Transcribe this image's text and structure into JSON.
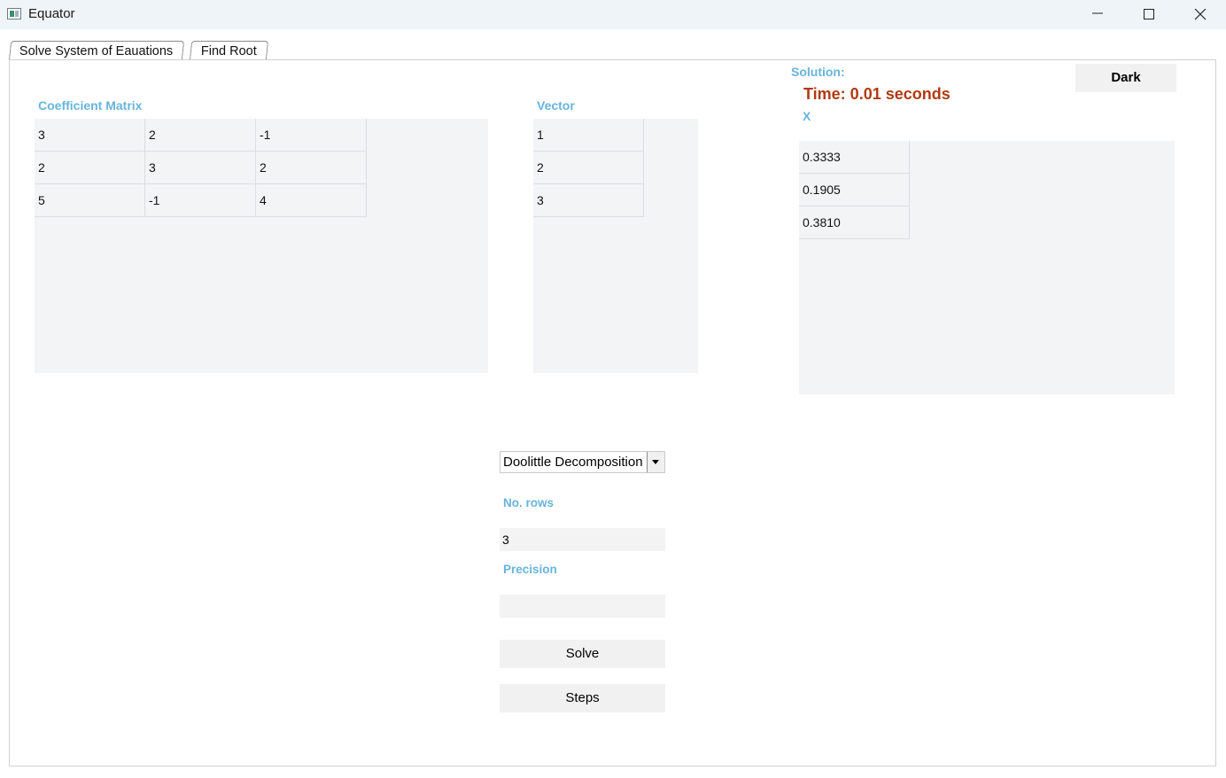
{
  "window": {
    "title": "Equator"
  },
  "tabs": [
    {
      "label": "Solve System of Eauations",
      "active": true
    },
    {
      "label": "Find Root",
      "active": false
    }
  ],
  "coefficient_matrix": {
    "label": "Coefficient Matrix",
    "rows": [
      [
        "3",
        "2",
        "-1"
      ],
      [
        "2",
        "3",
        "2"
      ],
      [
        "5",
        "-1",
        "4"
      ]
    ]
  },
  "vector": {
    "label": "Vector",
    "values": [
      "1",
      "2",
      "3"
    ]
  },
  "solution": {
    "label": "Solution:",
    "time": "Time: 0.01 seconds",
    "var_label": "X",
    "values": [
      "0.3333",
      "0.1905",
      "0.3810"
    ]
  },
  "theme_button": {
    "label": "Dark"
  },
  "method": {
    "selected": "Doolittle Decomposition"
  },
  "rows_field": {
    "label": "No. rows",
    "value": "3"
  },
  "precision_field": {
    "label": "Precision",
    "value": ""
  },
  "buttons": {
    "solve": "Solve",
    "steps": "Steps"
  },
  "colors": {
    "label_blue": "#67b4dd",
    "time_red": "#b03a11",
    "grid_bg": "#f3f4f6"
  }
}
